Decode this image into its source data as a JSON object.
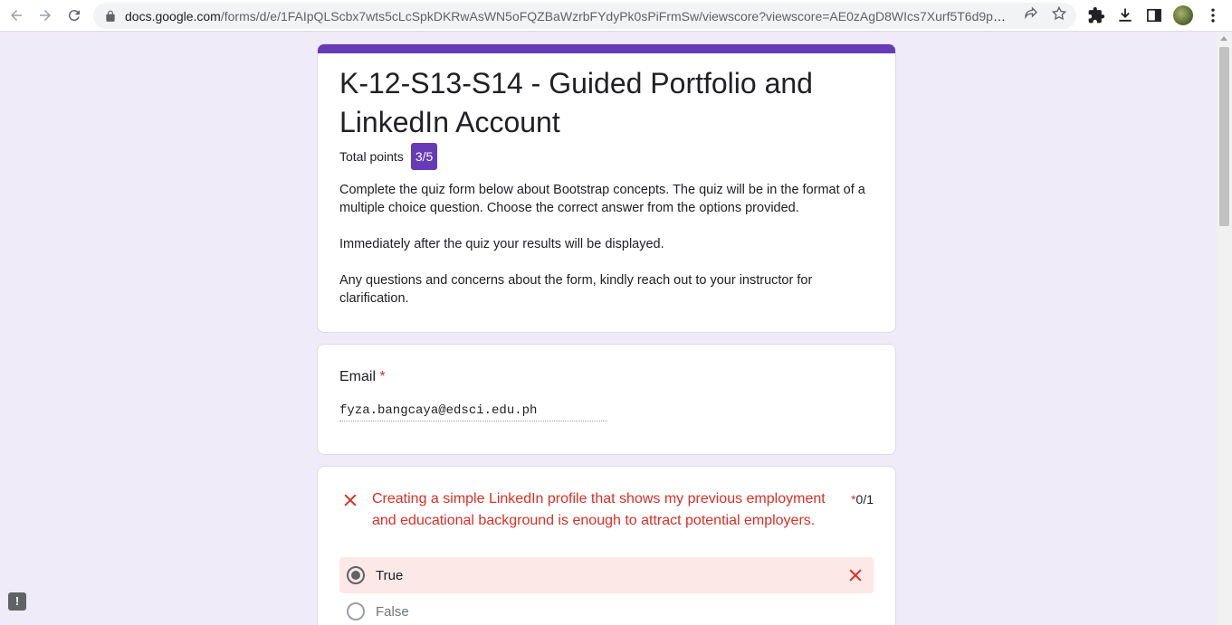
{
  "browser": {
    "url_domain": "docs.google.com",
    "url_path": "/forms/d/e/1FAIpQLScbx7wts5cLcSpkDKRwAsWN5oFQZBaWzrbFYdyPk0sPiFrmSw/viewscore?viewscore=AE0zAgD8WIcs7Xurf5T6d9p3GxIco..."
  },
  "form": {
    "title": "K-12-S13-S14 - Guided Portfolio and LinkedIn Account",
    "points_label": "Total points",
    "points_value": "3/5",
    "description": [
      "Complete the quiz form below about Bootstrap concepts. The quiz will be in the format of a multiple choice question. Choose the correct answer from the options provided.",
      "Immediately after the quiz your results will be displayed.",
      "Any questions and concerns about the form, kindly reach out to your instructor for clarification."
    ]
  },
  "email": {
    "label": "Email",
    "required_mark": "*",
    "value": "fyza.bangcaya@edsci.edu.ph"
  },
  "question": {
    "text": "Creating a simple LinkedIn profile that shows my previous employment and educational background is enough to attract potential employers.",
    "required_mark": "*",
    "score": "0/1",
    "options": [
      "True",
      "False"
    ],
    "selected": "True"
  },
  "colors": {
    "accent": "#673ab7",
    "error": "#d93025",
    "background": "#f0ebf8",
    "wrong_answer_bg": "#fce8e6"
  }
}
